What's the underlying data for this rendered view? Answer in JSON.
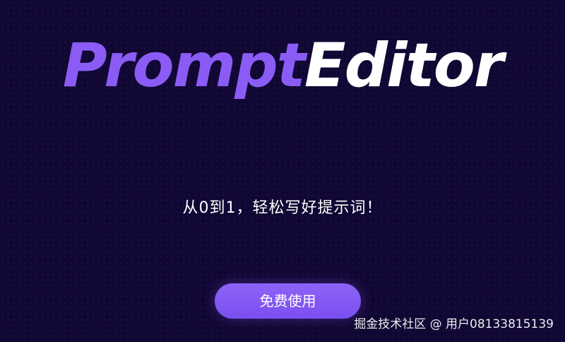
{
  "hero": {
    "logo_prompt": "Prompt",
    "logo_editor": "Editor",
    "tagline": "从0到1，轻松写好提示词！",
    "cta_label": "免费使用"
  },
  "watermark": {
    "text": "掘金技术社区 @ 用户08133815139"
  },
  "colors": {
    "background": "#110734",
    "brand_purple": "#8a5cf5",
    "white": "#ffffff"
  }
}
